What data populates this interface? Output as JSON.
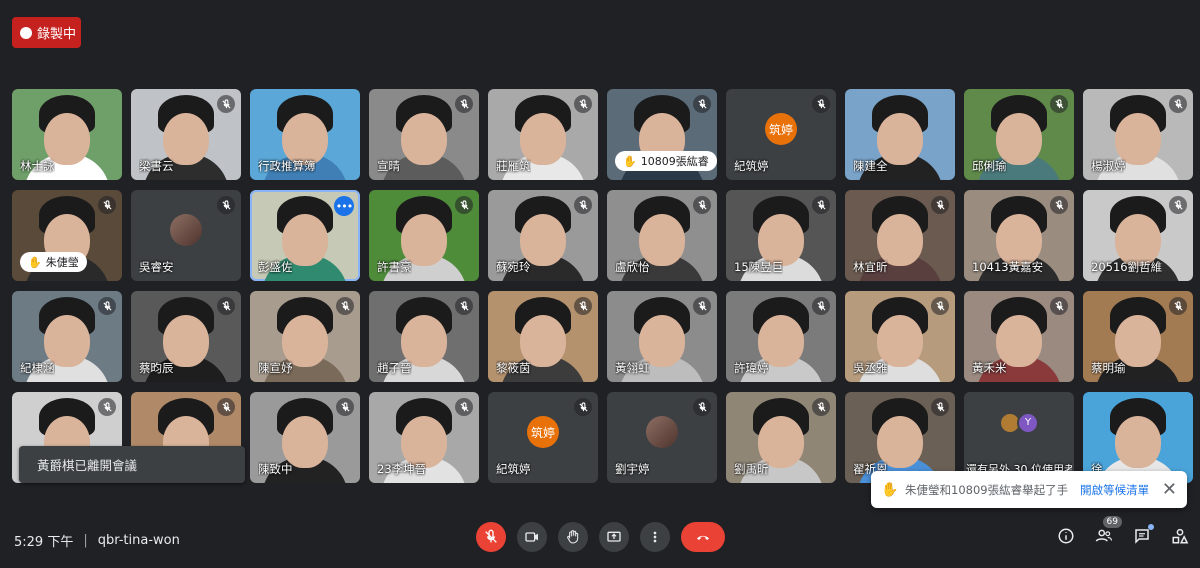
{
  "recording": {
    "label": "錄製中"
  },
  "tiles": [
    {
      "name": "林士詠",
      "muted": false,
      "kind": "video",
      "bg": "#6fa06a",
      "shirt": "#ffffff"
    },
    {
      "name": "梁書云",
      "muted": true,
      "kind": "video",
      "bg": "#bfc3c7",
      "shirt": "#2d2d2d"
    },
    {
      "name": "行政推算簿",
      "muted": false,
      "kind": "video",
      "bg": "#5aa7d8",
      "shirt": "#3f7fb5"
    },
    {
      "name": "宣晴",
      "muted": true,
      "kind": "video",
      "bg": "#8a8a8a",
      "shirt": "#5c5c5c"
    },
    {
      "name": "莊雁筑",
      "muted": true,
      "kind": "video",
      "bg": "#a9a9a9",
      "shirt": "#e8e8e8"
    },
    {
      "name": "10809張紘睿",
      "muted": true,
      "kind": "video-hand",
      "bg": "#5b6b78",
      "shirt": "#2b3a49"
    },
    {
      "name": "紀筑婷",
      "muted": true,
      "kind": "avatar",
      "avatar": "筑婷"
    },
    {
      "name": "陳建全",
      "muted": false,
      "kind": "video",
      "bg": "#7aa3c9",
      "shirt": "#222222"
    },
    {
      "name": "邱俐瑜",
      "muted": true,
      "kind": "video",
      "bg": "#5f8a4a",
      "shirt": "#4b7a7c"
    },
    {
      "name": "楊淑婷",
      "muted": true,
      "kind": "video",
      "bg": "#b9b9b9",
      "shirt": "#e0e0e0"
    },
    {
      "name": "朱倢瑩",
      "muted": true,
      "kind": "video-hand",
      "bg": "#5a4a3a",
      "shirt": "#2a2a2a"
    },
    {
      "name": "吳睿安",
      "muted": true,
      "kind": "avatar-photo"
    },
    {
      "name": "彭盛佐",
      "muted": false,
      "kind": "video-more",
      "bg": "#c5c9b5",
      "shirt": "#2f8a6f",
      "active": true
    },
    {
      "name": "許書豪",
      "muted": true,
      "kind": "video",
      "bg": "#4f8c3a",
      "shirt": "#cfcfcf"
    },
    {
      "name": "蘇宛玲",
      "muted": true,
      "kind": "video",
      "bg": "#9a9a9a",
      "shirt": "#2a2a2a"
    },
    {
      "name": "盧欣怡",
      "muted": true,
      "kind": "video",
      "bg": "#8f8f8f",
      "shirt": "#3a3a3a"
    },
    {
      "name": "15陳昱巨",
      "muted": true,
      "kind": "video",
      "bg": "#555555",
      "shirt": "#dcdcdc"
    },
    {
      "name": "林宜昕",
      "muted": true,
      "kind": "video",
      "bg": "#6b5a4f",
      "shirt": "#5a3f3f"
    },
    {
      "name": "10413黃嘉安",
      "muted": true,
      "kind": "video",
      "bg": "#9a8d80",
      "shirt": "#2c2c2c"
    },
    {
      "name": "20516劉哲維",
      "muted": true,
      "kind": "video",
      "bg": "#c9c9c9",
      "shirt": "#2f2f2f"
    },
    {
      "name": "紀棣涵",
      "muted": true,
      "kind": "video",
      "bg": "#6d7b85",
      "shirt": "#e0e0e0"
    },
    {
      "name": "蔡昀辰",
      "muted": true,
      "kind": "video",
      "bg": "#595959",
      "shirt": "#1e1e1e"
    },
    {
      "name": "陳宣妤",
      "muted": true,
      "kind": "video",
      "bg": "#a89c8f",
      "shirt": "#7a6a5a"
    },
    {
      "name": "趙子晉",
      "muted": true,
      "kind": "video",
      "bg": "#6f6f6f",
      "shirt": "#d8d8d8"
    },
    {
      "name": "黎筱茵",
      "muted": true,
      "kind": "video",
      "bg": "#b5926e",
      "shirt": "#3c3c3c"
    },
    {
      "name": "黃翎虹",
      "muted": true,
      "kind": "video",
      "bg": "#8c8c8c",
      "shirt": "#bdbdbd"
    },
    {
      "name": "許瑋婷",
      "muted": true,
      "kind": "video",
      "bg": "#7b7b7b",
      "shirt": "#c9c9c9"
    },
    {
      "name": "吳丞雅",
      "muted": true,
      "kind": "video",
      "bg": "#b79b7d",
      "shirt": "#dedede"
    },
    {
      "name": "黃禾米",
      "muted": true,
      "kind": "video",
      "bg": "#9a8a80",
      "shirt": "#8a3a3a"
    },
    {
      "name": "蔡明瑜",
      "muted": true,
      "kind": "video",
      "bg": "#a37b52",
      "shirt": "#222222"
    },
    {
      "name": "",
      "muted": true,
      "kind": "video",
      "bg": "#cfcfcf",
      "shirt": "#2c2c2c"
    },
    {
      "name": "",
      "muted": true,
      "kind": "video",
      "bg": "#b08a68",
      "shirt": "#3a3a3a"
    },
    {
      "name": "陳致中",
      "muted": true,
      "kind": "video",
      "bg": "#9a9a9a",
      "shirt": "#222222"
    },
    {
      "name": "23李坤晉",
      "muted": true,
      "kind": "video",
      "bg": "#a8a8a8",
      "shirt": "#e2e2e2"
    },
    {
      "name": "紀筑婷",
      "muted": true,
      "kind": "avatar",
      "avatar": "筑婷"
    },
    {
      "name": "劉宇婷",
      "muted": true,
      "kind": "avatar-photo"
    },
    {
      "name": "劉禹昕",
      "muted": true,
      "kind": "video",
      "bg": "#8f8676",
      "shirt": "#c7c7c7"
    },
    {
      "name": "翟祈恩",
      "muted": true,
      "kind": "video",
      "bg": "#6b6055",
      "shirt": "#4a90d9"
    },
    {
      "name": "還有另外 30 位使用者",
      "muted": false,
      "kind": "others"
    },
    {
      "name": "徐",
      "muted": false,
      "kind": "video",
      "bg": "#4aa3d9",
      "shirt": "#e7e7e7"
    }
  ],
  "left_notice": {
    "text": "黃爵棋已離開會議"
  },
  "hand_notice": {
    "text": "朱倢瑩和10809張紘睿舉起了手",
    "link": "開啟等候清單",
    "hand_icon": "hand-icon",
    "close_icon": "close-icon"
  },
  "bottom": {
    "time": "5:29 下午",
    "meeting_code": "qbr-tina-won",
    "participant_count": "69"
  },
  "colors": {
    "accent": "#1a73e8",
    "end_call": "#ea4335",
    "recording": "#c5221f",
    "background": "#202124"
  }
}
